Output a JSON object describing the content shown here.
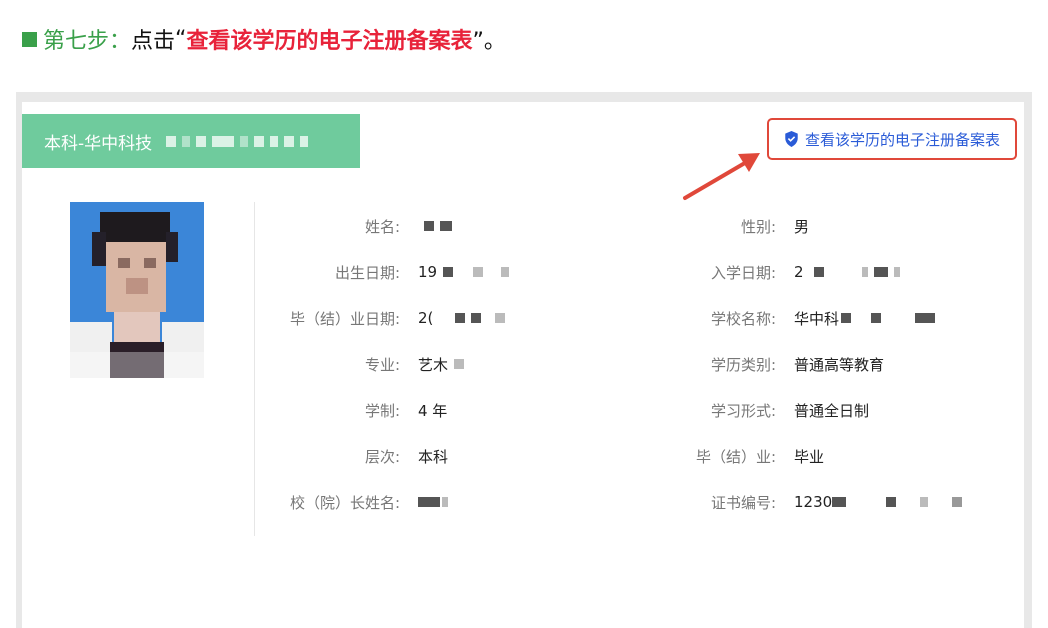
{
  "instruction": {
    "step_label": "第七步：",
    "prefix": "点击",
    "open_quote": "“",
    "link_text": "查看该学历的电子注册备案表",
    "close_quote": "”。"
  },
  "record": {
    "degree_tab": "本科-华中科技",
    "view_record_button": "查看该学历的电子注册备案表",
    "left_fields": [
      {
        "label": "姓名:",
        "value": ""
      },
      {
        "label": "出生日期:",
        "value": "19"
      },
      {
        "label": "毕（结）业日期:",
        "value": "2("
      },
      {
        "label": "专业:",
        "value": "艺木"
      },
      {
        "label": "学制:",
        "value": "4 年"
      },
      {
        "label": "层次:",
        "value": "本科"
      },
      {
        "label": "校（院）长姓名:",
        "value": ""
      }
    ],
    "right_fields": [
      {
        "label": "性别:",
        "value": "男"
      },
      {
        "label": "入学日期:",
        "value": "2"
      },
      {
        "label": "学校名称:",
        "value": "华中科"
      },
      {
        "label": "学历类别:",
        "value": "普通高等教育"
      },
      {
        "label": "学习形式:",
        "value": "普通全日制"
      },
      {
        "label": "毕（结）业:",
        "value": "毕业"
      },
      {
        "label": "证书编号:",
        "value": "1230"
      }
    ]
  },
  "colors": {
    "step_green": "#3aa04a",
    "highlight_red": "#e8233a",
    "tab_green": "#6fcb9d",
    "link_blue": "#2a5bd7",
    "annotation_red": "#e0483a"
  },
  "icons": {
    "record_link": "shield-check-icon",
    "annotation": "arrow-icon"
  }
}
